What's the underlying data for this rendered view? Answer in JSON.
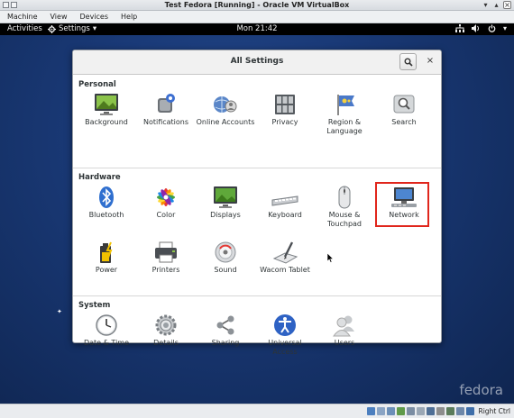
{
  "vbox": {
    "title": "Test Fedora [Running] - Oracle VM VirtualBox",
    "menu": [
      "Machine",
      "View",
      "Devices",
      "Help"
    ],
    "host_key": "Right Ctrl"
  },
  "topbar": {
    "activities": "Activities",
    "app_menu": "Settings",
    "app_menu_arrow": "▾",
    "clock": "Mon 21:42",
    "status_icons": [
      "network-icon",
      "volume-icon",
      "power-icon"
    ]
  },
  "dialog": {
    "title": "All Settings",
    "close": "×",
    "sections": {
      "personal": {
        "title": "Personal",
        "items": [
          {
            "label": "Background",
            "icon": "background-icon"
          },
          {
            "label": "Notifications",
            "icon": "notifications-icon"
          },
          {
            "label": "Online Accounts",
            "icon": "online-accounts-icon"
          },
          {
            "label": "Privacy",
            "icon": "privacy-icon"
          },
          {
            "label": "Region & Language",
            "icon": "region-language-icon"
          },
          {
            "label": "Search",
            "icon": "search-icon"
          }
        ]
      },
      "hardware": {
        "title": "Hardware",
        "items": [
          {
            "label": "Bluetooth",
            "icon": "bluetooth-icon"
          },
          {
            "label": "Color",
            "icon": "color-icon"
          },
          {
            "label": "Displays",
            "icon": "displays-icon"
          },
          {
            "label": "Keyboard",
            "icon": "keyboard-icon"
          },
          {
            "label": "Mouse & Touchpad",
            "icon": "mouse-icon"
          },
          {
            "label": "Network",
            "icon": "network-icon"
          },
          {
            "label": "Power",
            "icon": "power-icon"
          },
          {
            "label": "Printers",
            "icon": "printer-icon"
          },
          {
            "label": "Sound",
            "icon": "sound-icon"
          },
          {
            "label": "Wacom Tablet",
            "icon": "wacom-tablet-icon"
          }
        ]
      },
      "system": {
        "title": "System",
        "items": [
          {
            "label": "Date & Time",
            "icon": "clock-icon"
          },
          {
            "label": "Details",
            "icon": "gear-icon"
          },
          {
            "label": "Sharing",
            "icon": "share-icon"
          },
          {
            "label": "Universal Access",
            "icon": "accessibility-icon"
          },
          {
            "label": "Users",
            "icon": "users-icon"
          }
        ]
      }
    }
  },
  "desktop": {
    "brand": "fedora"
  },
  "colors": {
    "highlight": "#e0261c",
    "topbar": "#000000",
    "desktop": "#1a3a78"
  }
}
